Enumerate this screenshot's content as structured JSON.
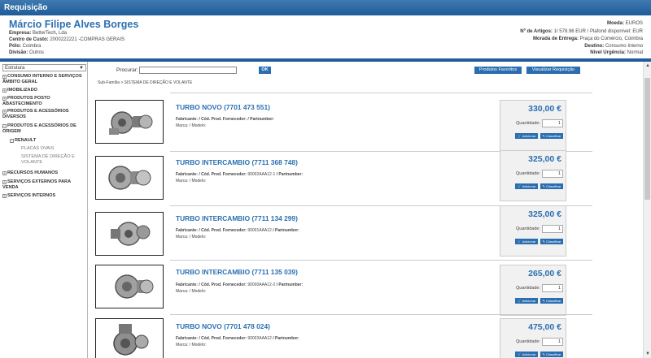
{
  "app": {
    "title": "Requisição"
  },
  "header": {
    "user_name": "Márcio Filipe Alves Borges",
    "left": [
      {
        "label": "Empresa:",
        "value": "BetterTech, Lda"
      },
      {
        "label": "Centro de Custo:",
        "value": "2000222221 -COMPRAS GERAIS"
      },
      {
        "label": "Pólo:",
        "value": "Coimbra"
      },
      {
        "label": "Divisão:",
        "value": "Outros"
      }
    ],
    "right": [
      {
        "label": "Moeda:",
        "value": "EUROS"
      },
      {
        "label": "Nº de Artigos:",
        "value": "1/ 578.96 EUR / Plafond disponível: EUR"
      },
      {
        "label": "Morada de Entrega:",
        "value": "Praça do Comércio, Coimbra"
      },
      {
        "label": "Destino:",
        "value": "Consumo Interno"
      },
      {
        "label": "Nível Urgência:",
        "value": "Normal"
      }
    ]
  },
  "sidebar": {
    "select_value": "Estrutura",
    "items": [
      {
        "sign": "+",
        "label": "CONSUMO INTERNO E SERVIÇOS ÂMBITO GERAL"
      },
      {
        "sign": "+",
        "label": "IMOBILIZADO"
      },
      {
        "sign": "+",
        "label": "PRODUTOS POSTO ABASTECIMENTO"
      },
      {
        "sign": "+",
        "label": "PRODUTOS E ACESSÓRIOS DIVERSOS"
      },
      {
        "sign": "−",
        "label": "PRODUTOS E ACESSÓRIOS DE ORIGEM"
      },
      {
        "sign": "−",
        "label": "RENAULT"
      },
      {
        "sign": "+",
        "label": "RECURSOS HUMANOS"
      },
      {
        "sign": "+",
        "label": "SERVIÇOS EXTERNOS PARA VENDA"
      },
      {
        "sign": "+",
        "label": "SERVIÇOS INTERNOS"
      }
    ],
    "subitems": [
      {
        "label": "PLACAS OVAIS"
      },
      {
        "label": "SISTEMA DE DIREÇÃO E VOLANTE"
      }
    ]
  },
  "toolbar": {
    "search_label": "Procurar:",
    "search_value": "",
    "ok_label": "OK",
    "favorites_label": "Produtos Favoritos",
    "view_label": "Visualizar Requisição"
  },
  "breadcrumb": "Sub-Família > SISTEMA DE DIREÇÃO E VOLANTE",
  "common": {
    "fabricante_label": "Fabricante: / Cód. Prod. Fornecedor:",
    "partnumber_label": "/ Partnumber:",
    "marca_label": "Marca: / Modelo:",
    "qty_label": "Quantidade:",
    "add_label": "Adicionar",
    "classify_label": "Classificar"
  },
  "products": [
    {
      "title": "TURBO NOVO (7701 473 551)",
      "supplier_code": "",
      "price": "330,00 €",
      "qty": "1",
      "image": "turbo-image"
    },
    {
      "title": "TURBO INTERCAMBIO (7711 368 748)",
      "supplier_code": "90002AAA12-1",
      "price": "325,00 €",
      "qty": "1",
      "image": "turbo-image"
    },
    {
      "title": "TURBO INTERCAMBIO (7711 134 299)",
      "supplier_code": "90001AAA12",
      "price": "325,00 €",
      "qty": "1",
      "image": "turbo-image"
    },
    {
      "title": "TURBO INTERCAMBIO (7711 135 039)",
      "supplier_code": "90000AAA12-2",
      "price": "265,00 €",
      "qty": "1",
      "image": "turbo-image"
    },
    {
      "title": "TURBO NOVO (7701 478 024)",
      "supplier_code": "90003AAA12",
      "price": "475,00 €",
      "qty": "1",
      "image": "turbo-image"
    }
  ],
  "colors": {
    "accent": "#2b70b2",
    "bar": "#1f5c98",
    "button": "#2a6db0"
  }
}
